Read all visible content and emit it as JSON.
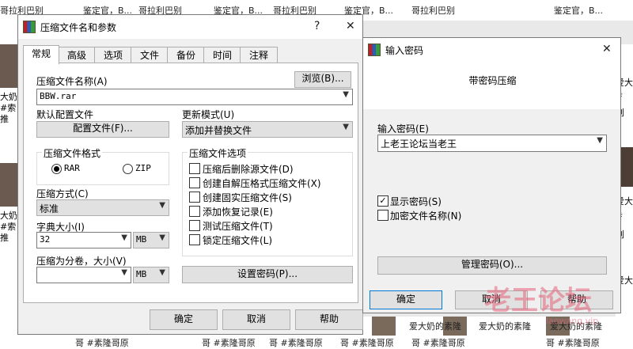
{
  "background": {
    "top_snippets": [
      "哥拉利巴别",
      "鉴定官，B...",
      "哥拉利巴别",
      "鉴定官，B...",
      "哥拉利巴别",
      "鉴定官，B...",
      "哥拉利巴别",
      "鉴定官，B..."
    ],
    "left_snippets": [
      "大奶",
      "#索",
      "推",
      "大奶",
      "#索",
      "推",
      "大奶",
      "#索"
    ],
    "right_snippets": [
      "爱大",
      "#",
      "创",
      "爱大",
      "#",
      "创",
      "爱大"
    ],
    "bottom_snippets": [
      "哥 #素隆哥原",
      "哥 #素隆哥原",
      "哥 #素隆哥原",
      "爱大奶的素隆",
      "爱大奶的素隆",
      "爱大奶的素隆",
      "哥 #素隆哥原",
      "哥 #素隆哥原",
      "哥 #素隆哥原"
    ],
    "watermark": "老王论坛",
    "watermark_url": "laowang.vip"
  },
  "archive_dialog": {
    "title": "压缩文件名和参数",
    "help_glyph": "?",
    "close_glyph": "✕",
    "tabs": [
      "常规",
      "高级",
      "选项",
      "文件",
      "备份",
      "时间",
      "注释"
    ],
    "archive_name_label": "压缩文件名称(A)",
    "browse_button": "浏览(B)...",
    "archive_name_value": "BBW.rar",
    "profile_label": "默认配置文件",
    "profile_button": "配置文件(F)...",
    "update_mode_label": "更新模式(U)",
    "update_mode_value": "添加并替换文件",
    "format_group_title": "压缩文件格式",
    "format_rar": "RAR",
    "format_zip": "ZIP",
    "format_selected": "RAR",
    "options_group_title": "压缩文件选项",
    "options": [
      {
        "label": "压缩后删除源文件(D)",
        "checked": false
      },
      {
        "label": "创建自解压格式压缩文件(X)",
        "checked": false
      },
      {
        "label": "创建固实压缩文件(S)",
        "checked": false
      },
      {
        "label": "添加恢复记录(E)",
        "checked": false
      },
      {
        "label": "测试压缩文件(T)",
        "checked": false
      },
      {
        "label": "锁定压缩文件(L)",
        "checked": false
      }
    ],
    "method_label": "压缩方式(C)",
    "method_value": "标准",
    "dict_label": "字典大小(I)",
    "dict_value": "32",
    "dict_unit": "MB",
    "split_label": "压缩为分卷，大小(V)",
    "split_value": "",
    "split_unit": "MB",
    "set_password_button": "设置密码(P)...",
    "ok_button": "确定",
    "cancel_button": "取消",
    "help_button": "帮助"
  },
  "password_dialog": {
    "title": "输入密码",
    "close_glyph": "✕",
    "heading": "带密码压缩",
    "password_label": "输入密码(E)",
    "password_value": "上老王论坛当老王",
    "show_password_label": "显示密码(S)",
    "show_password_checked": true,
    "encrypt_names_label": "加密文件名称(N)",
    "encrypt_names_checked": false,
    "manage_button": "管理密码(O)...",
    "ok_button": "确定",
    "cancel_button": "取消",
    "help_button": "帮助"
  }
}
